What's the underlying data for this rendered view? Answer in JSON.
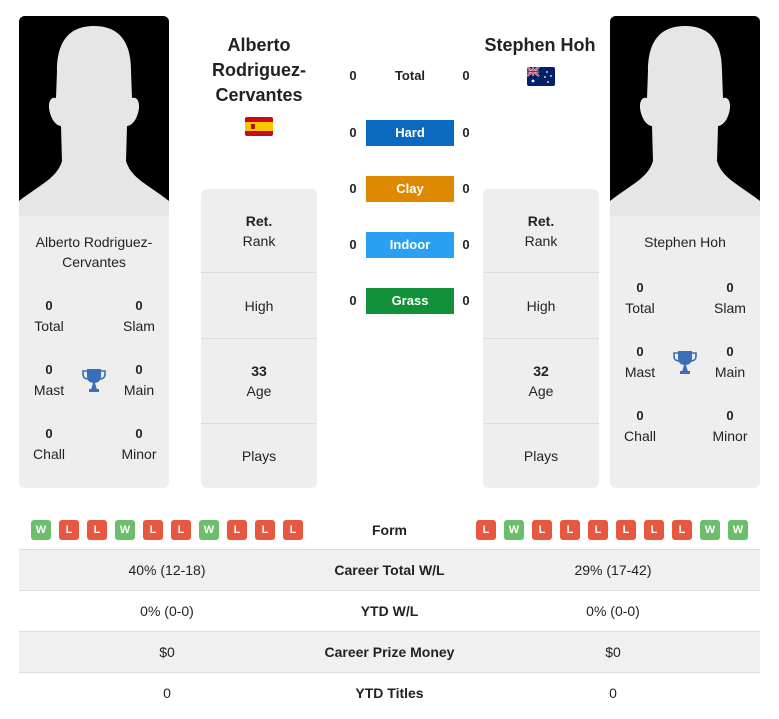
{
  "player1": {
    "name_lines": [
      "Alberto",
      "Rodriguez-",
      "Cervantes"
    ],
    "card_name_lines": [
      "Alberto Rodriguez-",
      "Cervantes"
    ],
    "country_flag": "spain-flag",
    "photo": "silhouette-placeholder",
    "titles": {
      "total": {
        "value": "0",
        "label": "Total"
      },
      "slam": {
        "value": "0",
        "label": "Slam"
      },
      "mast": {
        "value": "0",
        "label": "Mast"
      },
      "main": {
        "value": "0",
        "label": "Main"
      },
      "chall": {
        "value": "0",
        "label": "Chall"
      },
      "minor": {
        "value": "0",
        "label": "Minor"
      }
    },
    "rank": {
      "value": "Ret.",
      "label": "Rank"
    },
    "high": {
      "label": "High"
    },
    "age": {
      "value": "33",
      "label": "Age"
    },
    "plays": {
      "label": "Plays"
    },
    "form": [
      "W",
      "L",
      "L",
      "W",
      "L",
      "L",
      "W",
      "L",
      "L",
      "L"
    ]
  },
  "player2": {
    "name_lines": [
      "Stephen Hoh"
    ],
    "card_name_lines": [
      "Stephen Hoh"
    ],
    "country_flag": "australia-flag",
    "photo": "silhouette-placeholder",
    "titles": {
      "total": {
        "value": "0",
        "label": "Total"
      },
      "slam": {
        "value": "0",
        "label": "Slam"
      },
      "mast": {
        "value": "0",
        "label": "Mast"
      },
      "main": {
        "value": "0",
        "label": "Main"
      },
      "chall": {
        "value": "0",
        "label": "Chall"
      },
      "minor": {
        "value": "0",
        "label": "Minor"
      }
    },
    "rank": {
      "value": "Ret.",
      "label": "Rank"
    },
    "high": {
      "label": "High"
    },
    "age": {
      "value": "32",
      "label": "Age"
    },
    "plays": {
      "label": "Plays"
    },
    "form": [
      "L",
      "W",
      "L",
      "L",
      "L",
      "L",
      "L",
      "L",
      "W",
      "W"
    ]
  },
  "surfaces": [
    {
      "label": "Total",
      "p1": "0",
      "p2": "0",
      "color": ""
    },
    {
      "label": "Hard",
      "p1": "0",
      "p2": "0",
      "color": "#0a6abf"
    },
    {
      "label": "Clay",
      "p1": "0",
      "p2": "0",
      "color": "#dd8a00"
    },
    {
      "label": "Indoor",
      "p1": "0",
      "p2": "0",
      "color": "#2b9ff0"
    },
    {
      "label": "Grass",
      "p1": "0",
      "p2": "0",
      "color": "#11923a"
    }
  ],
  "form_label": "Form",
  "stats": [
    {
      "label": "Career Total W/L",
      "p1": "40% (12-18)",
      "p2": "29% (17-42)"
    },
    {
      "label": "YTD W/L",
      "p1": "0% (0-0)",
      "p2": "0% (0-0)"
    },
    {
      "label": "Career Prize Money",
      "p1": "$0",
      "p2": "$0"
    },
    {
      "label": "YTD Titles",
      "p1": "0",
      "p2": "0"
    }
  ],
  "colors": {
    "win": "#6cbd6c",
    "loss": "#e8573f",
    "trophy": "#3a6fb5",
    "panel": "#eeeeee"
  }
}
